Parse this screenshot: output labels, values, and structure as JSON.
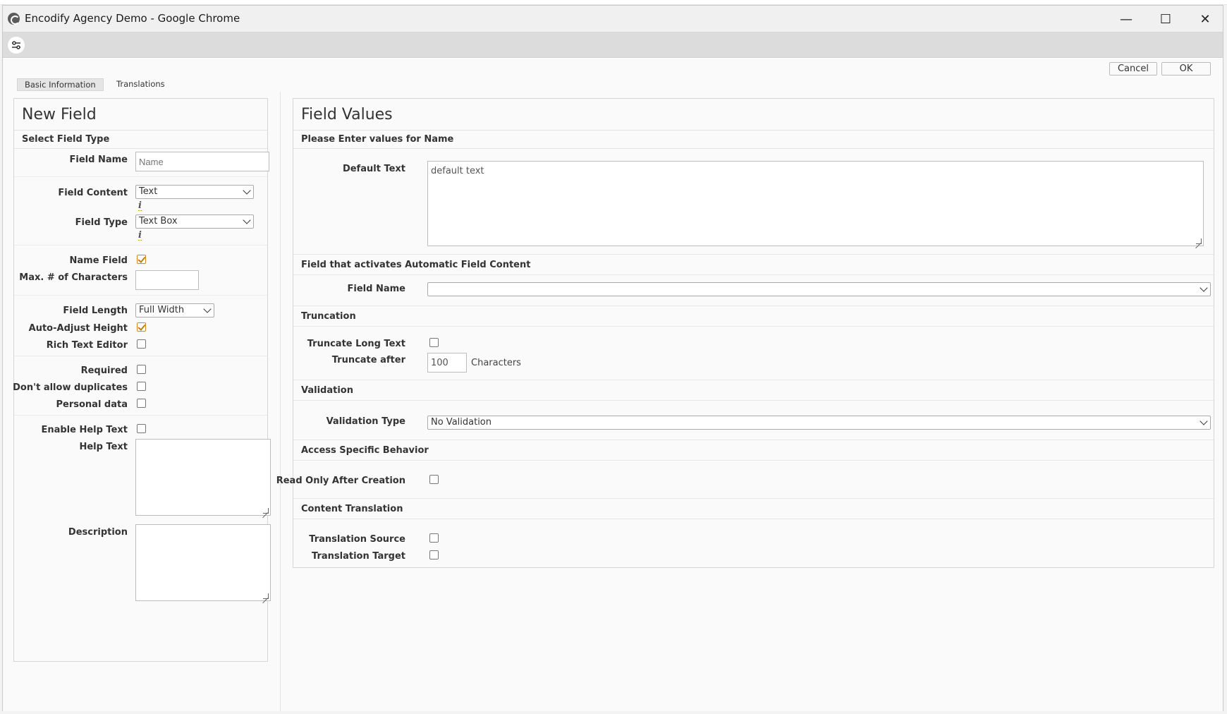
{
  "window": {
    "title": "Encodify Agency Demo - Google Chrome",
    "minimize": "—",
    "maximize": "☐",
    "close": "✕"
  },
  "actions": {
    "cancel": "Cancel",
    "ok": "OK"
  },
  "tabs": [
    "Basic Information",
    "Translations"
  ],
  "left": {
    "title": "New Field",
    "subtitle": "Select Field Type",
    "field_name_label": "Field Name",
    "field_name_placeholder": "Name",
    "field_content_label": "Field Content",
    "field_content_value": "Text",
    "field_type_label": "Field Type",
    "field_type_value": "Text Box",
    "info_glyph": "i",
    "name_field_label": "Name Field",
    "max_chars_label": "Max. # of Characters",
    "field_length_label": "Field Length",
    "field_length_value": "Full Width",
    "auto_adjust_label": "Auto-Adjust Height",
    "rich_text_label": "Rich Text Editor",
    "required_label": "Required",
    "no_duplicates_label": "Don't allow duplicates",
    "personal_data_label": "Personal data",
    "enable_help_label": "Enable Help Text",
    "help_text_label": "Help Text",
    "description_label": "Description"
  },
  "right": {
    "title": "Field Values",
    "subtitle": "Please Enter values for Name",
    "default_text_label": "Default Text",
    "default_text_value": "default text",
    "auto_content_section": "Field that activates Automatic Field Content",
    "field_name_label": "Field Name",
    "truncation_section": "Truncation",
    "truncate_long_label": "Truncate Long Text",
    "truncate_after_label": "Truncate after",
    "truncate_after_value": "100",
    "characters_label": "Characters",
    "validation_section": "Validation",
    "validation_type_label": "Validation Type",
    "validation_type_value": "No Validation",
    "access_section": "Access Specific Behavior",
    "read_only_label": "Read Only After Creation",
    "content_translation_section": "Content Translation",
    "translation_source_label": "Translation Source",
    "translation_target_label": "Translation Target"
  }
}
